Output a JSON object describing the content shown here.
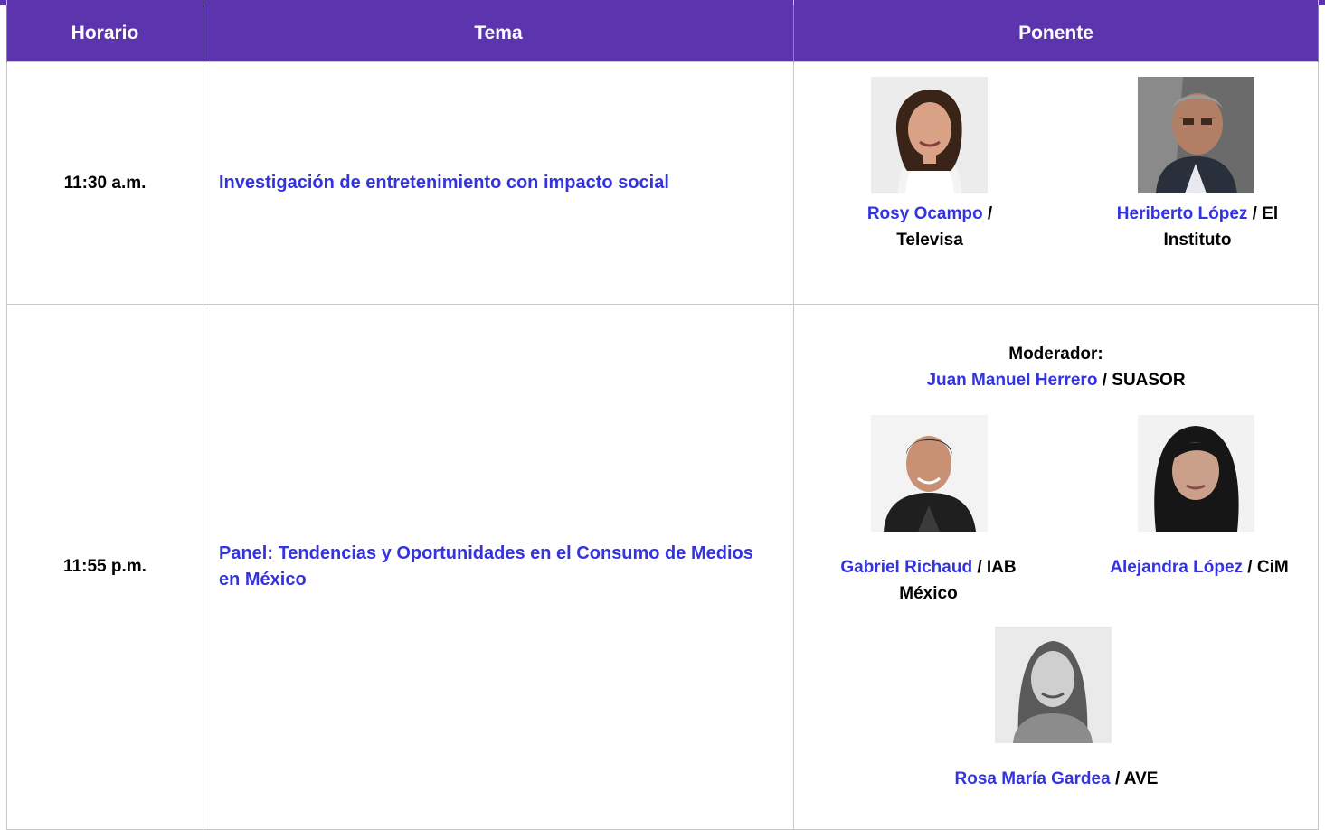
{
  "header": {
    "horario": "Horario",
    "tema": "Tema",
    "ponente": "Ponente"
  },
  "rows": [
    {
      "time": "11:30 a.m.",
      "topic": "Investigación de entretenimiento con impacto social",
      "speakers": [
        {
          "name": "Rosy Ocampo",
          "org_line1": " /",
          "org_line2": "Televisa"
        },
        {
          "name": "Heriberto López",
          "org_line1": " / El",
          "org_line2": "Instituto"
        }
      ]
    },
    {
      "time": "11:55 p.m.",
      "topic": "Panel: Tendencias y Oportunidades en el Consumo de Medios en México",
      "moderator_label": "Moderador:",
      "moderator": {
        "name": "Juan Manuel Herrero",
        "org": " / SUASOR"
      },
      "speakers": [
        {
          "name": "Gabriel Richaud",
          "org_line1": " / IAB",
          "org_line2": "México"
        },
        {
          "name": "Alejandra López",
          "org_line1": " / CiM",
          "org_line2": ""
        },
        {
          "name": "Rosa María Gardea",
          "org_line1": " / AVE",
          "org_line2": ""
        }
      ]
    }
  ]
}
